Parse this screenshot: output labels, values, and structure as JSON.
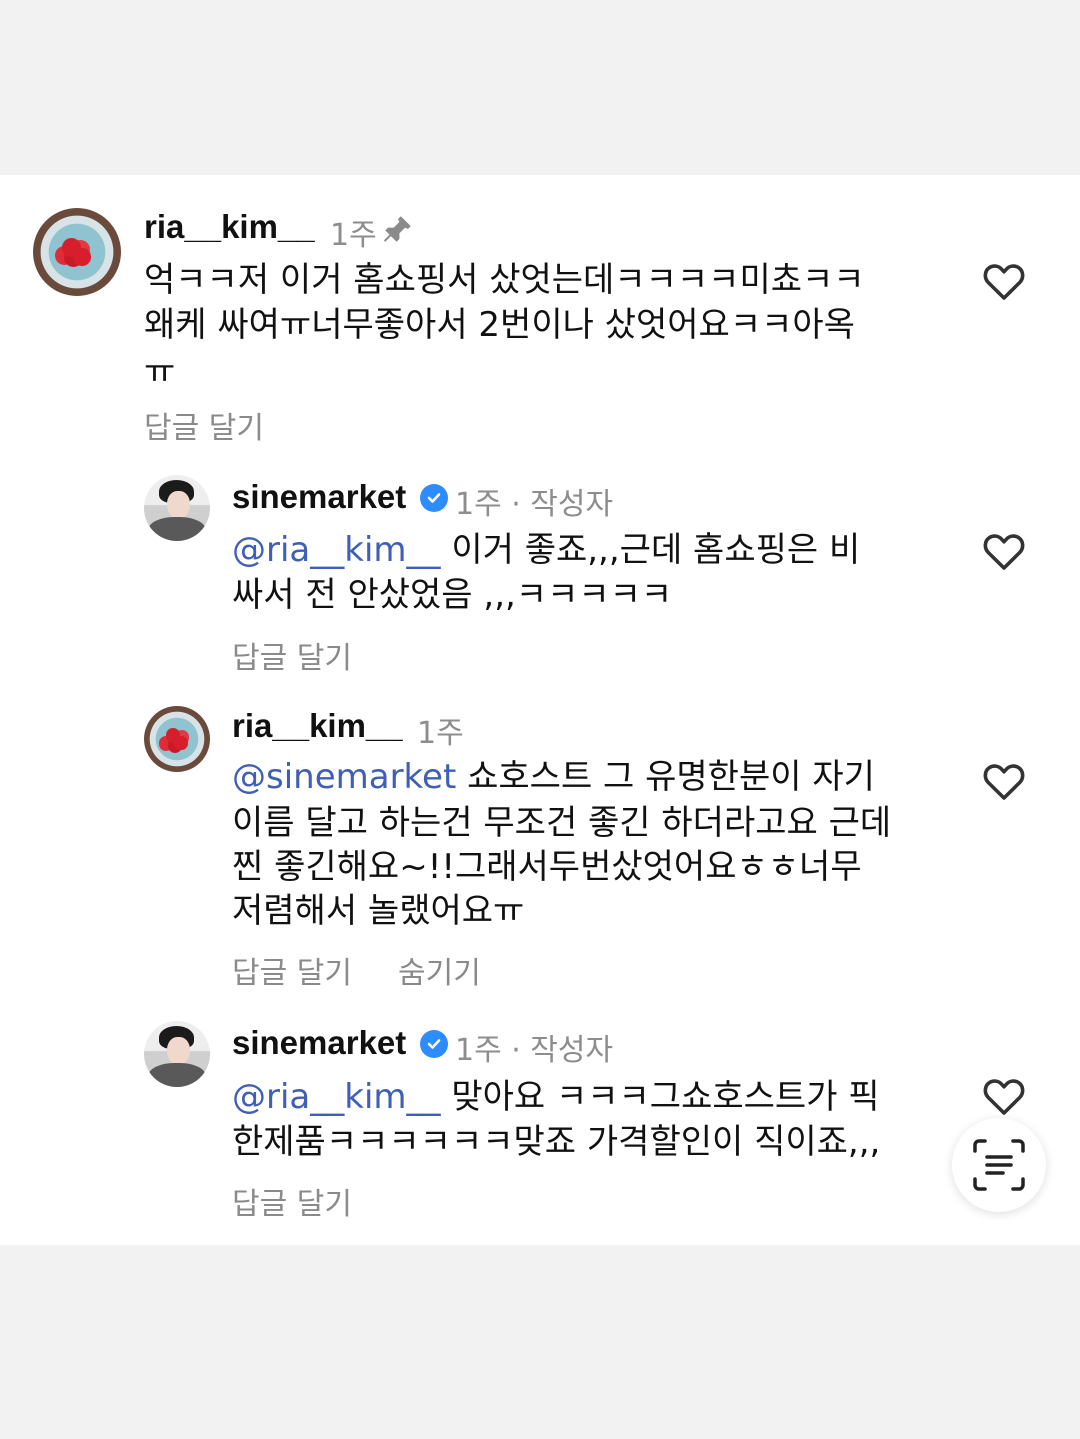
{
  "comments": [
    {
      "username": "ria__kim__",
      "time": "1주",
      "lines": [
        "억ㅋㅋ저 이거 홈쇼핑서 샀엇는데ㅋㅋㅋㅋ미쵸ㅋㅋ",
        "왜케 싸여ㅠ너무좋아서 2번이나 샀엇어요ㅋㅋ아옥",
        "ㅠ"
      ],
      "reply": "답글 달기"
    },
    {
      "username": "sinemarket",
      "meta": "1주 · 작성자",
      "mention": "@ria__kim__",
      "line1_rest": " 이거 좋죠,,,근데 홈쇼핑은 비",
      "line2": "싸서 전 안샀었음 ,,,ㅋㅋㅋㅋㅋ",
      "reply": "답글 달기"
    },
    {
      "username": "ria__kim__",
      "time": "1주",
      "mention": "@sinemarket",
      "line1_rest": " 쇼호스트 그 유명한분이 자기",
      "line2": "이름 달고 하는건 무조건 좋긴 하더라고요 근데",
      "line3": "찐 좋긴해요~!!그래서두번샀엇어요ㅎㅎ너무",
      "line4": "저렴해서 놀랬어요ㅠ",
      "reply": "답글 달기",
      "hide": "숨기기"
    },
    {
      "username": "sinemarket",
      "meta": "1주 · 작성자",
      "mention": "@ria__kim__",
      "line1_rest": " 맞아요 ㅋㅋㅋ그쇼호스트가 픽",
      "line2": "한제품ㅋㅋㅋㅋㅋㅋ맞죠 가격할인이 직이죠,,,",
      "reply": "답글 달기"
    }
  ],
  "colors": {
    "mention": "#3e5fb5",
    "verified": "#2d8cff",
    "meta": "#8d8d8d"
  },
  "icons": [
    "pin-icon",
    "verified-badge-icon",
    "heart-icon",
    "text-scan-icon"
  ]
}
